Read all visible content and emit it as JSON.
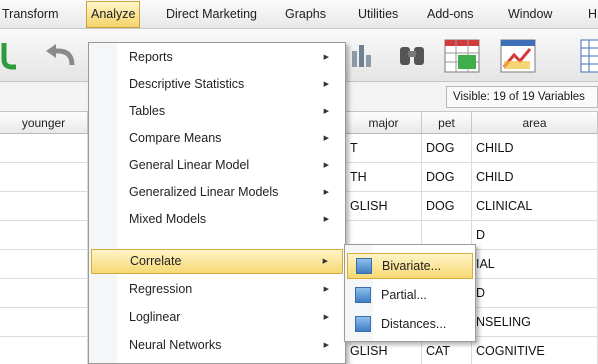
{
  "menubar": {
    "items": [
      "Transform",
      "Analyze",
      "Direct Marketing",
      "Graphs",
      "Utilities",
      "Add-ons",
      "Window",
      "H"
    ],
    "active_index": 1
  },
  "toolbar": {
    "icons": [
      "open-file-icon",
      "undo-icon",
      "chart-icon",
      "find-icon",
      "split-file-icon",
      "weight-cases-icon",
      "select-cases-icon"
    ]
  },
  "info": {
    "visible": "Visible: 19 of 19 Variables"
  },
  "grid": {
    "columns": [
      "younger",
      "major",
      "pet",
      "area"
    ],
    "rows": [
      [
        "",
        "T",
        "DOG",
        "CHILD"
      ],
      [
        "",
        "TH",
        "DOG",
        "CHILD"
      ],
      [
        "",
        "GLISH",
        "DOG",
        "CLINICAL"
      ],
      [
        "",
        "",
        "",
        "D"
      ],
      [
        "",
        "",
        "",
        "IAL"
      ],
      [
        "",
        "",
        "",
        "D"
      ],
      [
        "",
        "",
        "",
        "NSELING"
      ],
      [
        "",
        "GLISH",
        "CAT",
        "COGNITIVE"
      ]
    ]
  },
  "analyze_menu": {
    "items": [
      {
        "label": "Reports",
        "arrow": "▶"
      },
      {
        "label": "Descriptive Statistics",
        "arrow": "▶"
      },
      {
        "label": "Tables",
        "arrow": "▶"
      },
      {
        "label": "Compare Means",
        "arrow": "▶"
      },
      {
        "label": "General Linear Model",
        "arrow": "▶"
      },
      {
        "label": "Generalized Linear Models",
        "arrow": "▶"
      },
      {
        "label": "Mixed Models",
        "arrow": "▶"
      },
      {
        "label": "Correlate",
        "arrow": "▶"
      },
      {
        "label": "Regression",
        "arrow": "▶"
      },
      {
        "label": "Loglinear",
        "arrow": "▶"
      },
      {
        "label": "Neural Networks",
        "arrow": "▶"
      }
    ],
    "highlighted": "Correlate"
  },
  "correlate_submenu": {
    "items": [
      "Bivariate...",
      "Partial...",
      "Distances..."
    ],
    "highlighted": "Bivariate..."
  },
  "colors": {
    "highlight": "#f7d873",
    "highlight_border": "#d8ab3e",
    "menu_border": "#9a9a9a"
  }
}
